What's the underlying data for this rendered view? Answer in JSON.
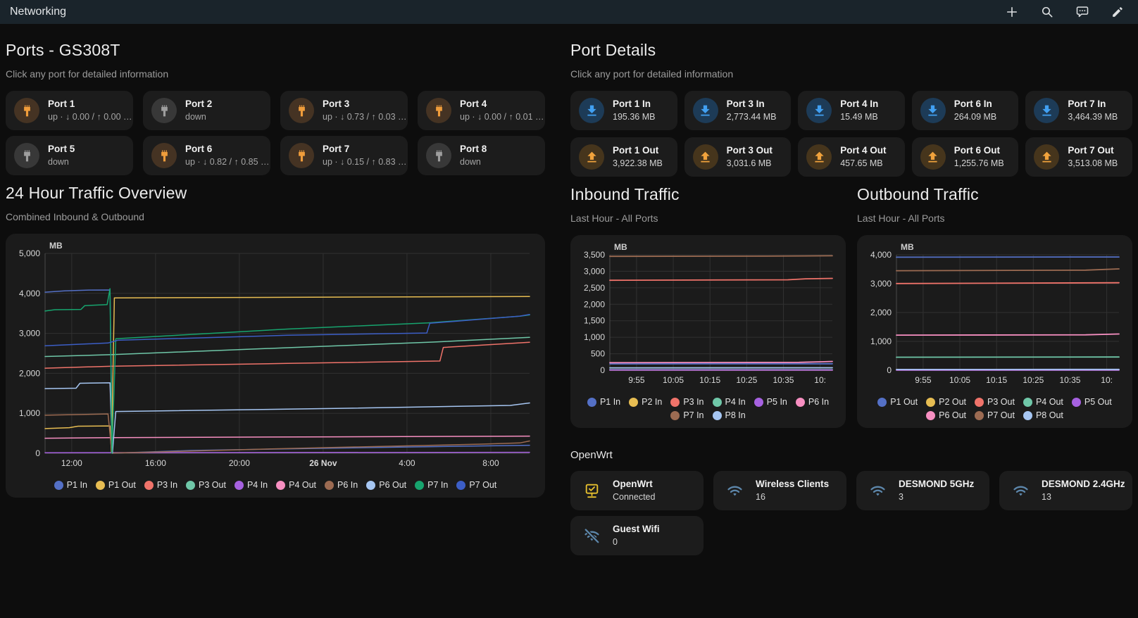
{
  "header": {
    "title": "Networking",
    "icons": [
      "plus",
      "search",
      "assist",
      "edit"
    ]
  },
  "colors": {
    "appbar_bg": "#1a242b",
    "page_bg": "#0d0d0d",
    "card_bg": "#1c1c1c",
    "port_up_icon": "#f09d3b",
    "port_down_icon": "#9e9e9e",
    "download_icon": "#41a0f2",
    "upload_icon": "#f0a23c",
    "openwrt_icon": "#e6c02e",
    "wifi_icon": "#5d87ab"
  },
  "ports_panel": {
    "title": "Ports - GS308T",
    "subtitle": "Click any port for detailed information",
    "ports": [
      {
        "name": "Port 1",
        "state": "up",
        "status": "up · ↓ 0.00 / ↑ 0.00 …"
      },
      {
        "name": "Port 2",
        "state": "down",
        "status": "down"
      },
      {
        "name": "Port 3",
        "state": "up",
        "status": "up · ↓ 0.73 / ↑ 0.03 …"
      },
      {
        "name": "Port 4",
        "state": "up",
        "status": "up · ↓ 0.00 / ↑ 0.01 …"
      },
      {
        "name": "Port 5",
        "state": "down",
        "status": "down"
      },
      {
        "name": "Port 6",
        "state": "up",
        "status": "up · ↓ 0.82 / ↑ 0.85 …"
      },
      {
        "name": "Port 7",
        "state": "up",
        "status": "up · ↓ 0.15 / ↑ 0.83 …"
      },
      {
        "name": "Port 8",
        "state": "down",
        "status": "down"
      }
    ]
  },
  "port_details": {
    "title": "Port Details",
    "subtitle": "Click any port for detailed information",
    "in": [
      {
        "name": "Port 1 In",
        "value": "195.36 MB"
      },
      {
        "name": "Port 3 In",
        "value": "2,773.44 MB"
      },
      {
        "name": "Port 4 In",
        "value": "15.49 MB"
      },
      {
        "name": "Port 6 In",
        "value": "264.09 MB"
      },
      {
        "name": "Port 7 In",
        "value": "3,464.39 MB"
      }
    ],
    "out": [
      {
        "name": "Port 1 Out",
        "value": "3,922.38 MB"
      },
      {
        "name": "Port 3 Out",
        "value": "3,031.6 MB"
      },
      {
        "name": "Port 4 Out",
        "value": "457.65 MB"
      },
      {
        "name": "Port 6 Out",
        "value": "1,255.76 MB"
      },
      {
        "name": "Port 7 Out",
        "value": "3,513.08 MB"
      }
    ]
  },
  "openwrt": {
    "title": "OpenWrt",
    "cards": [
      {
        "name": "OpenWrt",
        "value": "Connected",
        "icon": "monitor-check"
      },
      {
        "name": "Wireless Clients",
        "value": "16",
        "icon": "wifi"
      },
      {
        "name": "DESMOND 5GHz",
        "value": "3",
        "icon": "wifi"
      },
      {
        "name": "DESMOND 2.4GHz",
        "value": "13",
        "icon": "wifi"
      },
      {
        "name": "Guest Wifi",
        "value": "0",
        "icon": "wifi-off"
      }
    ]
  },
  "chart_data": [
    {
      "id": "traffic24",
      "type": "line",
      "title": "24 Hour Traffic Overview",
      "subtitle": "Combined Inbound & Outbound",
      "unit": "MB",
      "ylim": [
        0,
        5000
      ],
      "lw": 1.5,
      "grid": true,
      "legend_position": "bottom",
      "y_ticks": [
        {
          "v": 5000,
          "label": "5,000"
        },
        {
          "v": 4000,
          "label": "4,000"
        },
        {
          "v": 3000,
          "label": "3,000"
        },
        {
          "v": 2000,
          "label": "2,000"
        },
        {
          "v": 1000,
          "label": "1,000"
        },
        {
          "v": 0,
          "label": "0"
        }
      ],
      "x_ticks": [
        {
          "pos": 0.055,
          "label": "12:00"
        },
        {
          "pos": 0.228,
          "label": "16:00"
        },
        {
          "pos": 0.401,
          "label": "20:00"
        },
        {
          "pos": 0.574,
          "label": "26 Nov",
          "bold": true
        },
        {
          "pos": 0.747,
          "label": "4:00"
        },
        {
          "pos": 0.92,
          "label": "8:00"
        }
      ],
      "series": [
        {
          "name": "P1 In",
          "color": "#5470c6",
          "points": [
            [
              0,
              4030
            ],
            [
              0.04,
              4062
            ],
            [
              0.09,
              4082
            ],
            [
              0.134,
              4085
            ],
            [
              0.139,
              2
            ],
            [
              0.3,
              70
            ],
            [
              0.6,
              130
            ],
            [
              0.97,
              195
            ],
            [
              1,
              200
            ]
          ]
        },
        {
          "name": "P1 Out",
          "color": "#e7bd52",
          "points": [
            [
              0,
              618
            ],
            [
              0.05,
              640
            ],
            [
              0.068,
              678
            ],
            [
              0.134,
              684
            ],
            [
              0.137,
              15
            ],
            [
              0.143,
              3888
            ],
            [
              0.5,
              3902
            ],
            [
              1,
              3922
            ]
          ]
        },
        {
          "name": "P3 In",
          "color": "#f0736a",
          "points": [
            [
              0,
              2128
            ],
            [
              0.14,
              2180
            ],
            [
              0.5,
              2248
            ],
            [
              0.815,
              2308
            ],
            [
              0.822,
              2648
            ],
            [
              0.97,
              2756
            ],
            [
              1,
              2778
            ]
          ]
        },
        {
          "name": "P3 Out",
          "color": "#6fc7a8",
          "points": [
            [
              0,
              2420
            ],
            [
              0.14,
              2468
            ],
            [
              0.5,
              2640
            ],
            [
              0.8,
              2782
            ],
            [
              1,
              2900
            ]
          ]
        },
        {
          "name": "P4 In",
          "color": "#a661e0",
          "points": [
            [
              0,
              14
            ],
            [
              1,
              24
            ]
          ]
        },
        {
          "name": "P4 Out",
          "color": "#f78fc1",
          "points": [
            [
              0,
              376
            ],
            [
              0.14,
              392
            ],
            [
              0.6,
              412
            ],
            [
              1,
              430
            ]
          ]
        },
        {
          "name": "P6 In",
          "color": "#9c6b52",
          "points": [
            [
              0,
              952
            ],
            [
              0.13,
              984
            ],
            [
              0.138,
              6
            ],
            [
              0.5,
              120
            ],
            [
              0.9,
              228
            ],
            [
              0.98,
              258
            ],
            [
              1,
              308
            ]
          ]
        },
        {
          "name": "P6 Out",
          "color": "#a6c6f2",
          "points": [
            [
              0,
              1618
            ],
            [
              0.064,
              1628
            ],
            [
              0.072,
              1752
            ],
            [
              0.134,
              1762
            ],
            [
              0.139,
              6
            ],
            [
              0.146,
              1046
            ],
            [
              0.6,
              1122
            ],
            [
              0.96,
              1198
            ],
            [
              1,
              1258
            ]
          ]
        },
        {
          "name": "P7 In",
          "color": "#17a46e",
          "points": [
            [
              0,
              3558
            ],
            [
              0.02,
              3592
            ],
            [
              0.074,
              3598
            ],
            [
              0.082,
              3694
            ],
            [
              0.128,
              3718
            ],
            [
              0.134,
              4118
            ],
            [
              0.138,
              4
            ],
            [
              0.146,
              2866
            ],
            [
              0.5,
              3108
            ],
            [
              0.79,
              3262
            ],
            [
              0.98,
              3428
            ],
            [
              1,
              3462
            ]
          ]
        },
        {
          "name": "P7 Out",
          "color": "#3c5ec6",
          "points": [
            [
              0,
              2688
            ],
            [
              0.13,
              2758
            ],
            [
              0.15,
              2828
            ],
            [
              0.5,
              2952
            ],
            [
              0.788,
              3008
            ],
            [
              0.794,
              3252
            ],
            [
              0.98,
              3432
            ],
            [
              1,
              3472
            ]
          ]
        }
      ]
    },
    {
      "id": "inbound",
      "type": "line",
      "title": "Inbound Traffic",
      "subtitle": "Last Hour - All Ports",
      "unit": "MB",
      "ylim": [
        0,
        3500
      ],
      "lw": 1.8,
      "grid": true,
      "legend_position": "bottom",
      "y_ticks": [
        {
          "v": 3500,
          "label": "3,500"
        },
        {
          "v": 3000,
          "label": "3,000"
        },
        {
          "v": 2500,
          "label": "2,500"
        },
        {
          "v": 2000,
          "label": "2,000"
        },
        {
          "v": 1500,
          "label": "1,500"
        },
        {
          "v": 1000,
          "label": "1,000"
        },
        {
          "v": 500,
          "label": "500"
        },
        {
          "v": 0,
          "label": "0"
        }
      ],
      "x_ticks": [
        {
          "pos": 0.12,
          "label": "9:55"
        },
        {
          "pos": 0.285,
          "label": "10:05"
        },
        {
          "pos": 0.45,
          "label": "10:15"
        },
        {
          "pos": 0.615,
          "label": "10:25"
        },
        {
          "pos": 0.78,
          "label": "10:35"
        },
        {
          "pos": 0.945,
          "label": "10:"
        }
      ],
      "series": [
        {
          "name": "P1 In",
          "color": "#5470c6",
          "points": [
            [
              0,
              192
            ],
            [
              1,
              197
            ]
          ]
        },
        {
          "name": "P2 In",
          "color": "#e7bd52",
          "points": [
            [
              0,
              2
            ],
            [
              1,
              2
            ]
          ]
        },
        {
          "name": "P3 In",
          "color": "#f0736a",
          "points": [
            [
              0,
              2728
            ],
            [
              0.8,
              2742
            ],
            [
              0.88,
              2772
            ],
            [
              1,
              2786
            ]
          ]
        },
        {
          "name": "P4 In",
          "color": "#6fc7a8",
          "points": [
            [
              0,
              14
            ],
            [
              1,
              16
            ]
          ]
        },
        {
          "name": "P5 In",
          "color": "#a661e0",
          "points": [
            [
              0,
              6
            ],
            [
              1,
              6
            ]
          ]
        },
        {
          "name": "P6 In",
          "color": "#f78fc1",
          "points": [
            [
              0,
              228
            ],
            [
              0.85,
              238
            ],
            [
              0.95,
              256
            ],
            [
              1,
              266
            ]
          ]
        },
        {
          "name": "P7 In",
          "color": "#9c6b52",
          "points": [
            [
              0,
              3452
            ],
            [
              0.7,
              3460
            ],
            [
              1,
              3470
            ]
          ]
        },
        {
          "name": "P8 In",
          "color": "#a6c6f2",
          "points": [
            [
              0,
              72
            ],
            [
              1,
              74
            ]
          ]
        }
      ]
    },
    {
      "id": "outbound",
      "type": "line",
      "title": "Outbound Traffic",
      "subtitle": "Last Hour - All Ports",
      "unit": "MB",
      "ylim": [
        0,
        4000
      ],
      "lw": 1.8,
      "grid": true,
      "legend_position": "bottom",
      "y_ticks": [
        {
          "v": 4000,
          "label": "4,000"
        },
        {
          "v": 3000,
          "label": "3,000"
        },
        {
          "v": 2000,
          "label": "2,000"
        },
        {
          "v": 1000,
          "label": "1,000"
        },
        {
          "v": 0,
          "label": "0"
        }
      ],
      "x_ticks": [
        {
          "pos": 0.12,
          "label": "9:55"
        },
        {
          "pos": 0.285,
          "label": "10:05"
        },
        {
          "pos": 0.45,
          "label": "10:15"
        },
        {
          "pos": 0.615,
          "label": "10:25"
        },
        {
          "pos": 0.78,
          "label": "10:35"
        },
        {
          "pos": 0.945,
          "label": "10:"
        }
      ],
      "series": [
        {
          "name": "P1 Out",
          "color": "#5470c6",
          "points": [
            [
              0,
              3916
            ],
            [
              1,
              3924
            ]
          ]
        },
        {
          "name": "P2 Out",
          "color": "#e7bd52",
          "points": [
            [
              0,
              2
            ],
            [
              1,
              2
            ]
          ]
        },
        {
          "name": "P3 Out",
          "color": "#f0736a",
          "points": [
            [
              0,
              3006
            ],
            [
              1,
              3032
            ]
          ]
        },
        {
          "name": "P4 Out",
          "color": "#6fc7a8",
          "points": [
            [
              0,
              452
            ],
            [
              1,
              458
            ]
          ]
        },
        {
          "name": "P5 Out",
          "color": "#a661e0",
          "points": [
            [
              0,
              6
            ],
            [
              1,
              6
            ]
          ]
        },
        {
          "name": "P6 Out",
          "color": "#f78fc1",
          "points": [
            [
              0,
              1216
            ],
            [
              0.85,
              1228
            ],
            [
              1,
              1256
            ]
          ]
        },
        {
          "name": "P7 Out",
          "color": "#9c6b52",
          "points": [
            [
              0,
              3448
            ],
            [
              0.85,
              3468
            ],
            [
              1,
              3512
            ]
          ]
        },
        {
          "name": "P8 Out",
          "color": "#a6c6f2",
          "points": [
            [
              0,
              26
            ],
            [
              1,
              30
            ]
          ]
        }
      ]
    }
  ]
}
